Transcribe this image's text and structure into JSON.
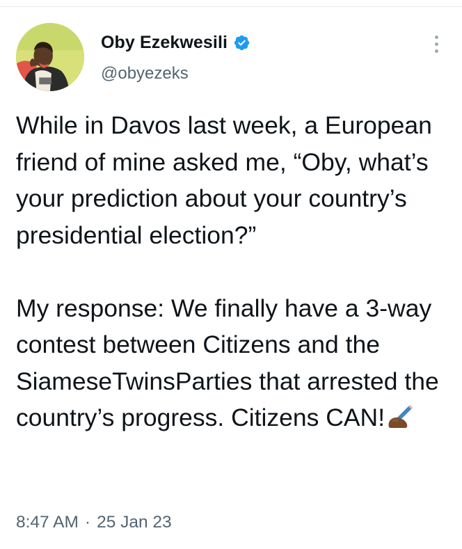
{
  "author": {
    "display_name": "Oby Ezekwesili",
    "handle": "@obyezeks",
    "verified": true
  },
  "tweet": {
    "paragraph_1": "While in Davos last week, a European friend of mine asked me, “Oby, what’s your prediction about your country’s presidential election?”",
    "paragraph_2": "My response: We finally have a 3-way contest between Citizens and the SiameseTwinsParties that arrested the country’s progress. Citizens CAN!",
    "emoji": "writing-hand-icon",
    "time": "8:47 AM",
    "separator": "·",
    "date": "25 Jan 23"
  },
  "icons": {
    "verified_badge": "verified-badge-icon",
    "more_menu": "more-options-icon"
  },
  "colors": {
    "text": "#0f1419",
    "secondary_text": "#536471",
    "verified_blue": "#1d9bf0",
    "divider": "#e6ecf0"
  }
}
